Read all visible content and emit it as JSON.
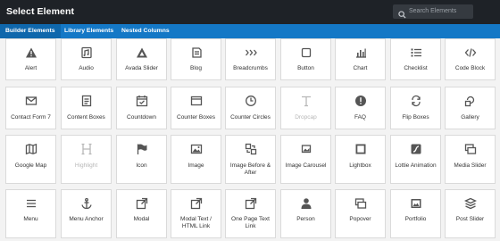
{
  "header": {
    "title": "Select Element",
    "search_placeholder": "Search Elements"
  },
  "tabs": [
    {
      "label": "Builder Elements",
      "active": true
    },
    {
      "label": "Library Elements",
      "active": false
    },
    {
      "label": "Nested Columns",
      "active": false
    }
  ],
  "elements": [
    {
      "label": "Alert",
      "icon": "alert-triangle-icon"
    },
    {
      "label": "Audio",
      "icon": "audio-icon"
    },
    {
      "label": "Avada Slider",
      "icon": "slider-triangle-icon"
    },
    {
      "label": "Blog",
      "icon": "blog-icon"
    },
    {
      "label": "Breadcrumbs",
      "icon": "breadcrumbs-icon"
    },
    {
      "label": "Button",
      "icon": "button-icon"
    },
    {
      "label": "Chart",
      "icon": "chart-icon"
    },
    {
      "label": "Checklist",
      "icon": "checklist-icon"
    },
    {
      "label": "Code Block",
      "icon": "code-icon"
    },
    {
      "label": "Contact Form 7",
      "icon": "envelope-icon"
    },
    {
      "label": "Content Boxes",
      "icon": "content-boxes-icon"
    },
    {
      "label": "Countdown",
      "icon": "calendar-icon"
    },
    {
      "label": "Counter Boxes",
      "icon": "counter-box-icon"
    },
    {
      "label": "Counter Circles",
      "icon": "counter-circle-icon"
    },
    {
      "label": "Dropcap",
      "icon": "dropcap-icon",
      "disabled": true
    },
    {
      "label": "FAQ",
      "icon": "faq-icon"
    },
    {
      "label": "Flip Boxes",
      "icon": "flip-icon"
    },
    {
      "label": "Gallery",
      "icon": "gallery-icon"
    },
    {
      "label": "Google Map",
      "icon": "map-icon"
    },
    {
      "label": "Highlight",
      "icon": "highlight-icon",
      "disabled": true
    },
    {
      "label": "Icon",
      "icon": "flag-icon"
    },
    {
      "label": "Image",
      "icon": "image-icon"
    },
    {
      "label": "Image Before & After",
      "icon": "image-compare-icon"
    },
    {
      "label": "Image Carousel",
      "icon": "image-carousel-icon"
    },
    {
      "label": "Lightbox",
      "icon": "lightbox-icon"
    },
    {
      "label": "Lottie Animation",
      "icon": "lottie-icon"
    },
    {
      "label": "Media Slider",
      "icon": "media-slider-icon"
    },
    {
      "label": "Menu",
      "icon": "menu-icon"
    },
    {
      "label": "Menu Anchor",
      "icon": "anchor-icon"
    },
    {
      "label": "Modal",
      "icon": "external-link-icon"
    },
    {
      "label": "Modal Text / HTML Link",
      "icon": "external-link-icon"
    },
    {
      "label": "One Page Text Link",
      "icon": "external-link-icon"
    },
    {
      "label": "Person",
      "icon": "person-icon"
    },
    {
      "label": "Popover",
      "icon": "popover-icon"
    },
    {
      "label": "Portfolio",
      "icon": "portfolio-icon"
    },
    {
      "label": "Post Slider",
      "icon": "post-slider-icon"
    }
  ]
}
